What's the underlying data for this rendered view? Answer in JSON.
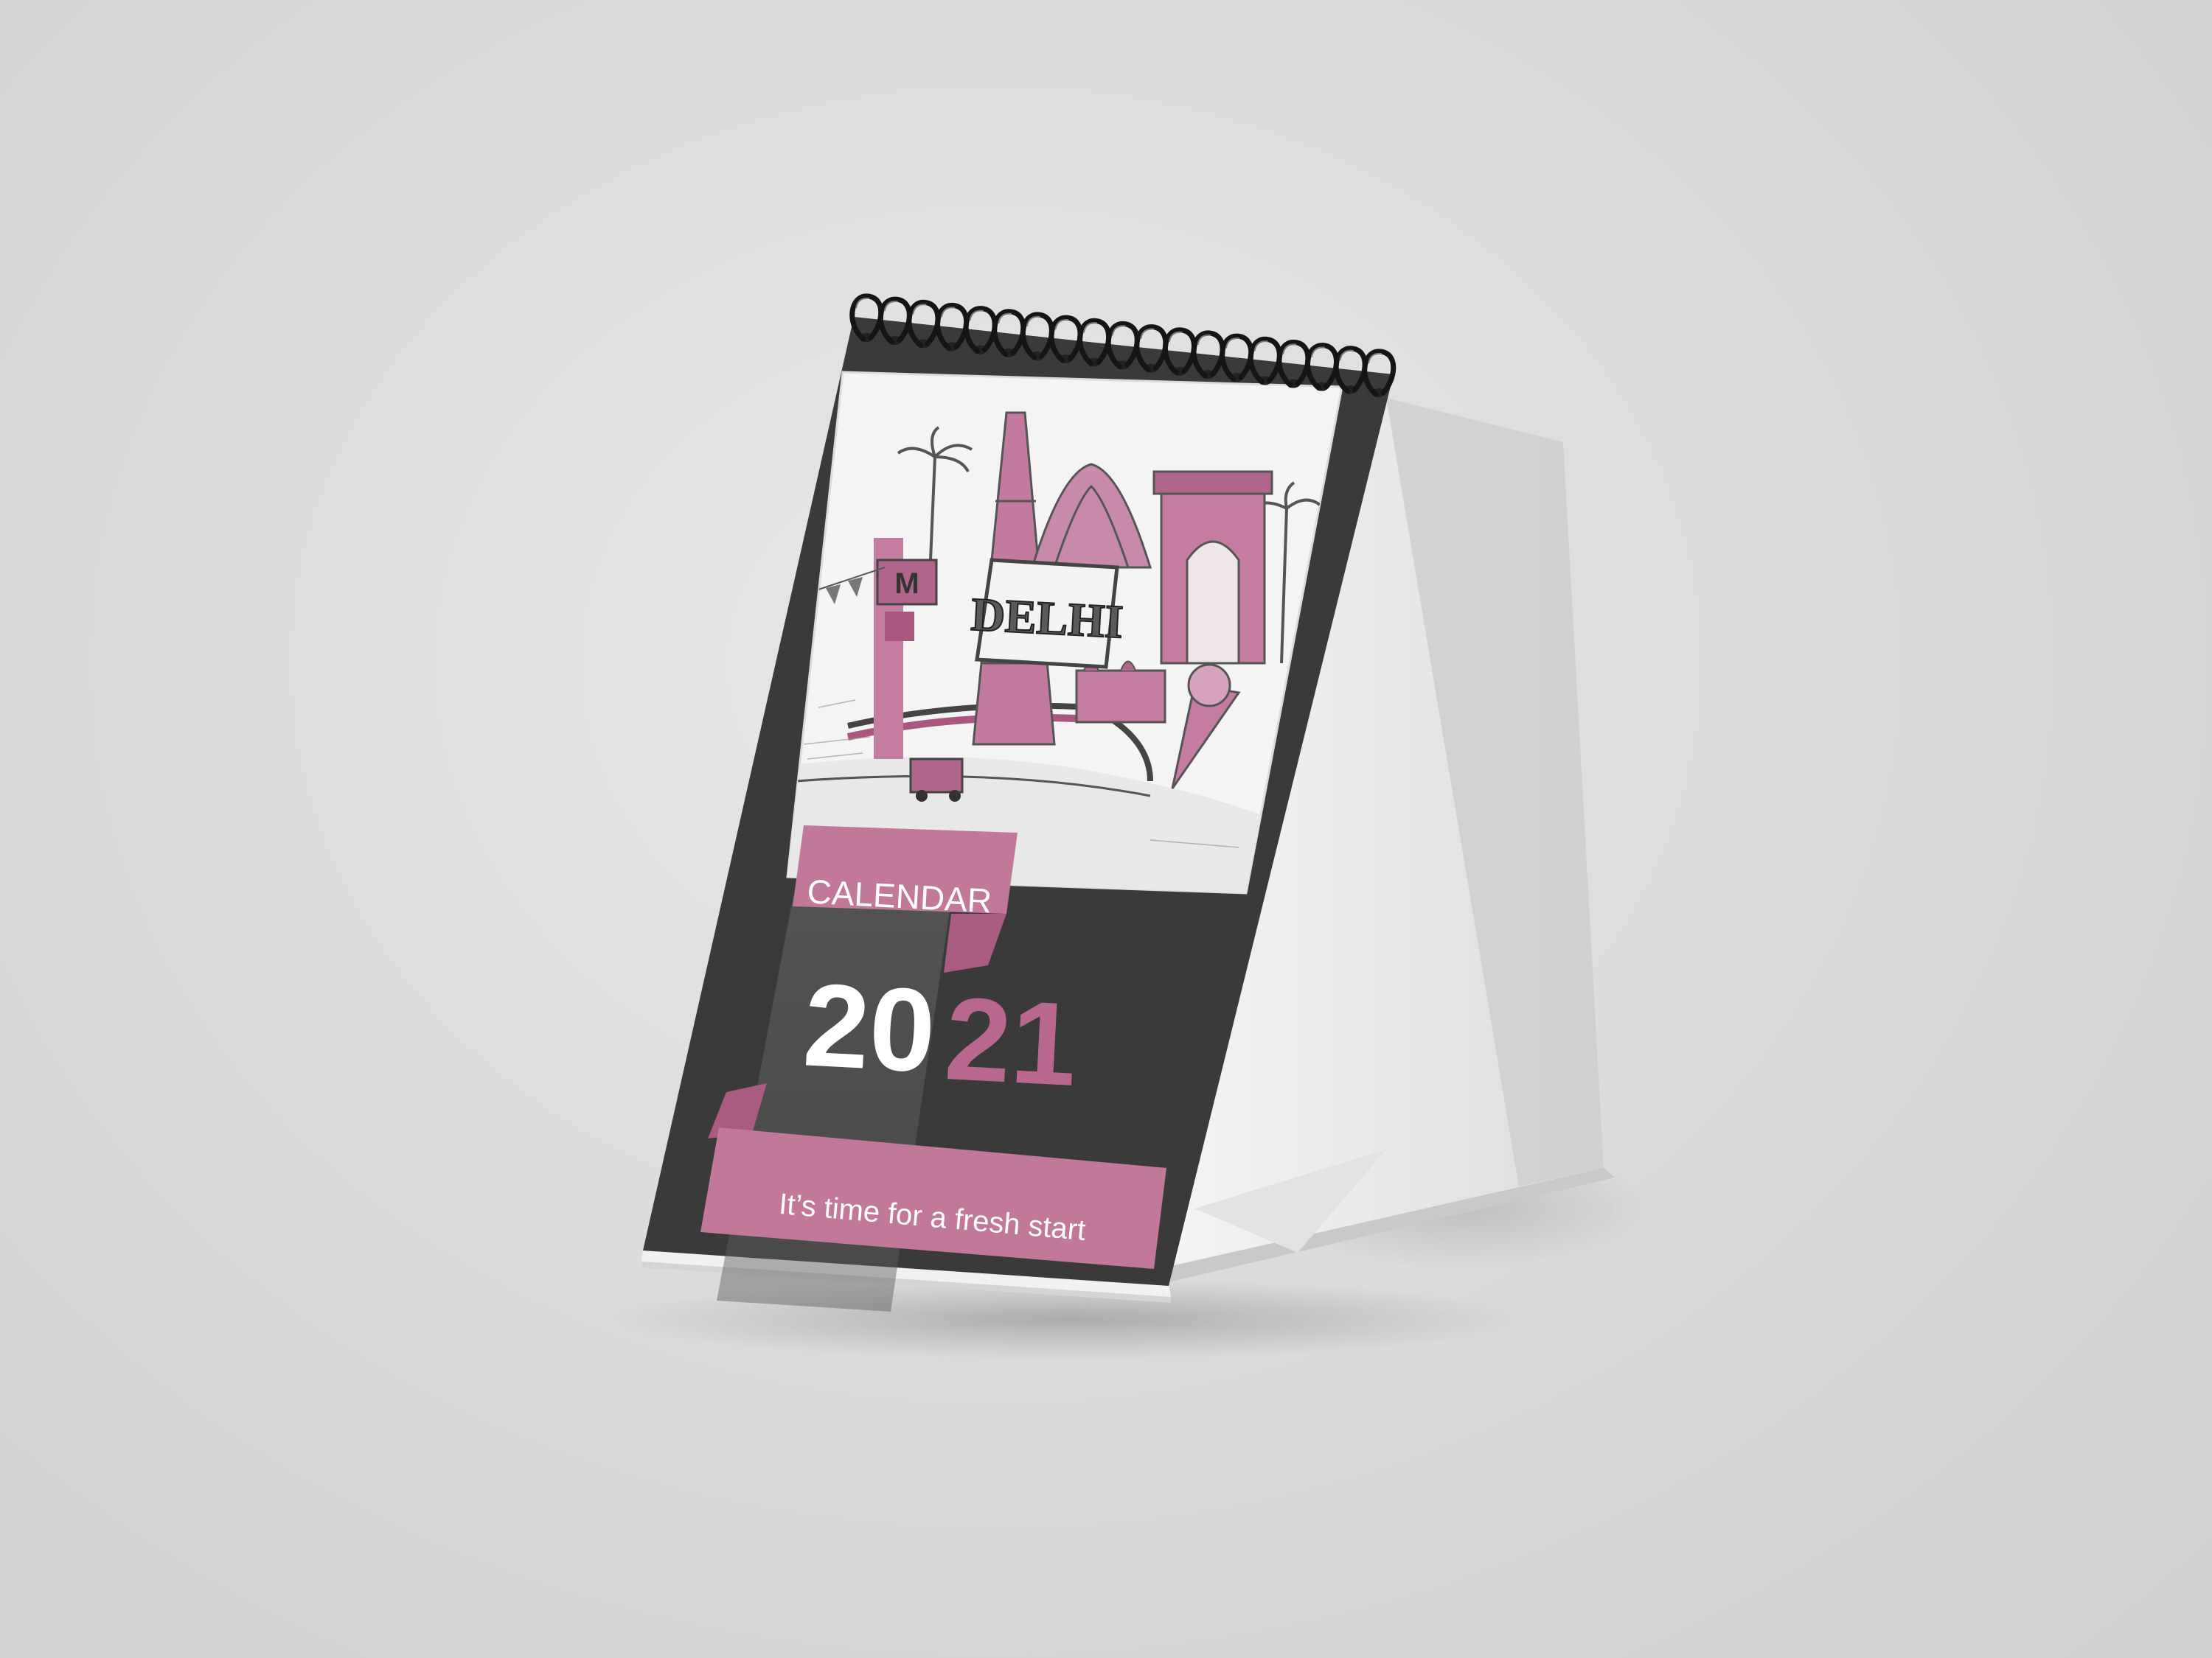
{
  "calendar": {
    "label": "CALENDAR",
    "year_first": "20",
    "year_second": "21",
    "tagline": "It’s time for a fresh start"
  },
  "illustration": {
    "sign_text": "DELHI"
  },
  "colors": {
    "background": "#dcdddf",
    "cover": "#3a3a3b",
    "accent_pink": "#b8688f",
    "year_white": "#ffffff",
    "year_pink": "#b8688f",
    "stand": "#f0f0f0",
    "spiral": "#1a1a1a"
  }
}
